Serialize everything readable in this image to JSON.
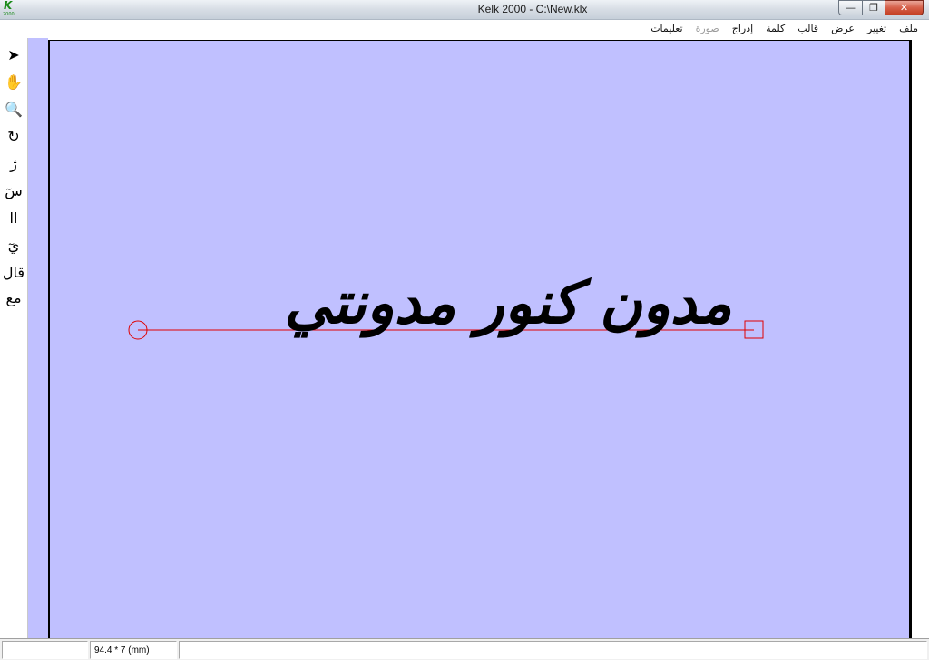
{
  "window": {
    "title": "Kelk 2000 - C:\\New.klx",
    "logo_letter": "K",
    "logo_year": "2000",
    "minimize": "—",
    "maximize": "❐",
    "close": "✕"
  },
  "menu": {
    "items": [
      {
        "label": "ملف",
        "enabled": true
      },
      {
        "label": "تغيير",
        "enabled": true
      },
      {
        "label": "عرض",
        "enabled": true
      },
      {
        "label": "قالب",
        "enabled": true
      },
      {
        "label": "كلمة",
        "enabled": true
      },
      {
        "label": "إدراج",
        "enabled": true
      },
      {
        "label": "صورة",
        "enabled": false
      },
      {
        "label": "تعليمات",
        "enabled": true
      }
    ]
  },
  "toolbox": {
    "tools": [
      {
        "name": "pointer-tool-icon",
        "glyph": "➤"
      },
      {
        "name": "hand-tool-icon",
        "glyph": "✋"
      },
      {
        "name": "zoom-tool-icon",
        "glyph": "🔍"
      },
      {
        "name": "rotate-tool-icon",
        "glyph": "↻"
      },
      {
        "name": "letter-kashida-tool-icon",
        "glyph": "ژ"
      },
      {
        "name": "letter-stretch-tool-icon",
        "glyph": "سٓ"
      },
      {
        "name": "alef-tool-icon",
        "glyph": "اا"
      },
      {
        "name": "ya-tool-icon",
        "glyph": "يٓ"
      },
      {
        "name": "word-tool-icon",
        "glyph": "قال"
      },
      {
        "name": "ligature-tool-icon",
        "glyph": "مع"
      }
    ]
  },
  "canvas": {
    "text": "مدون كنور مدونتي",
    "page_color": "#c0c0ff",
    "baseline_color": "#e00000"
  },
  "status": {
    "cell1": "",
    "size": "94.4 * 7 (mm)",
    "cell3": ""
  }
}
